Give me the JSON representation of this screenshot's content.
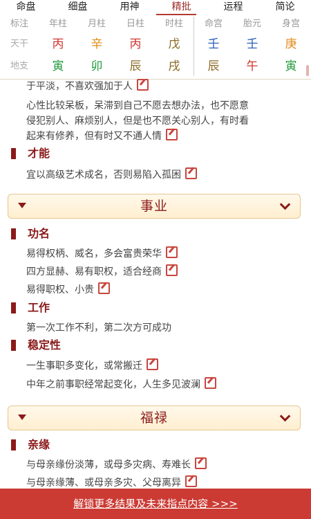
{
  "tabs": [
    {
      "label": "命盘"
    },
    {
      "label": "细盘"
    },
    {
      "label": "用神"
    },
    {
      "label": "精批"
    },
    {
      "label": "运程"
    },
    {
      "label": "简论"
    }
  ],
  "active_tab_index": 3,
  "grid": {
    "headers": [
      "标注",
      "年柱",
      "月柱",
      "日柱",
      "时柱",
      "命宫",
      "胎元",
      "身宫"
    ],
    "tiangan": {
      "label": "天干",
      "chars": [
        "丙",
        "辛",
        "丙",
        "戊",
        "壬",
        "壬",
        "庚"
      ]
    },
    "dizhi": {
      "label": "地支",
      "chars": [
        "寅",
        "卯",
        "辰",
        "戌",
        "辰",
        "午",
        "寅"
      ]
    }
  },
  "colors": {
    "fire_red": "#d0342c",
    "metal_orange": "#e18b16",
    "earth_brown": "#8a6a23",
    "water_blue": "#2c5fbf",
    "wood_green": "#1f9a3b",
    "dark_red": "#8b1a1a",
    "unlock_bar": "#cb3b34"
  },
  "content": {
    "personality_lines": [
      "于平淡，不喜欢强加于人",
      "心性比较呆板，呆滞到自己不愿去想办法，也不愿意",
      "侵犯别人、麻烦别人，但是也不愿关心别人，有时看",
      "起来有修养，但有时又不通人情"
    ],
    "talent": {
      "title": "才能",
      "lines": [
        "宜以高级艺术成名，否则易陷入孤困"
      ]
    },
    "career_banner": "事业",
    "fame": {
      "title": "功名",
      "lines": [
        "易得权柄、威名，多会富贵荣华",
        "四方显赫、易有职权，适合经商",
        "易得职权、小贵"
      ]
    },
    "work": {
      "title": "工作",
      "lines": [
        "第一次工作不利，第二次方可成功"
      ]
    },
    "stability": {
      "title": "稳定性",
      "lines": [
        "一生事职多变化，或常搬迁",
        "中年之前事职经常起变化，人生多见波澜"
      ]
    },
    "fortune_banner": "福禄",
    "kinship": {
      "title": "亲缘",
      "lines": [
        "与母亲缘份淡薄，或母多灾病、寿难长",
        "与母亲缘薄、或母亲多灾、父母离异"
      ]
    }
  },
  "footer": {
    "unlock_label": "解锁更多结果及未来指点内容 >>>"
  }
}
